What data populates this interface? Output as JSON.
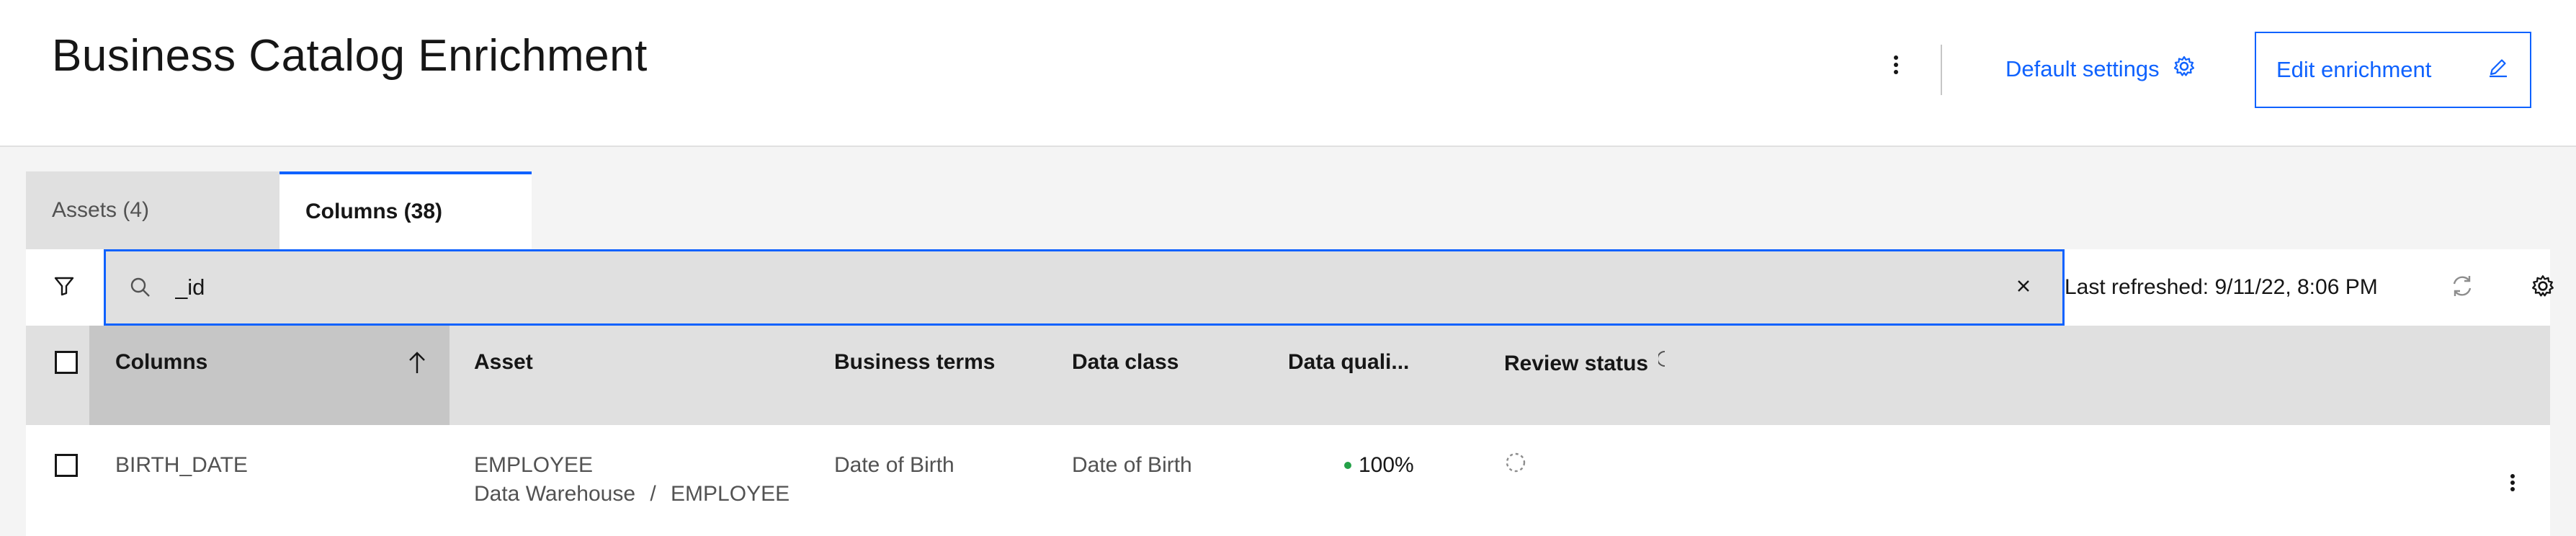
{
  "header": {
    "title": "Business Catalog Enrichment",
    "default_settings_label": "Default settings",
    "edit_enrichment_label": "Edit enrichment"
  },
  "tabs": [
    {
      "label": "Assets (4)",
      "selected": false
    },
    {
      "label": "Columns (38)",
      "selected": true
    }
  ],
  "toolbar": {
    "search_value": "_id",
    "last_refreshed": "Last refreshed: 9/11/22, 8:06 PM"
  },
  "table": {
    "headers": [
      "Columns",
      "Asset",
      "Business terms",
      "Data class",
      "Data quali...",
      "Review status"
    ],
    "sort_column": "Columns",
    "sort_direction": "ascending",
    "rows": [
      {
        "column": "BIRTH_DATE",
        "asset": "EMPLOYEE",
        "asset_path_parent": "Data Warehouse",
        "asset_path_separator": "/",
        "asset_path_child": "EMPLOYEE",
        "business_terms": "Date of Birth",
        "data_class": "Date of Birth",
        "data_quality": "100%"
      }
    ]
  },
  "colors": {
    "accent": "#0f62fe",
    "quality_ok": "#24a148",
    "header_bg": "#e0e0e0",
    "sorted_header_bg": "#c6c6c6"
  },
  "icons": [
    "overflow-menu-icon",
    "gear-icon",
    "edit-pencil-icon",
    "filter-icon",
    "search-icon",
    "close-icon",
    "refresh-icon",
    "settings-icon",
    "sort-arrow-up-icon",
    "info-icon",
    "review-status-pending-icon"
  ]
}
